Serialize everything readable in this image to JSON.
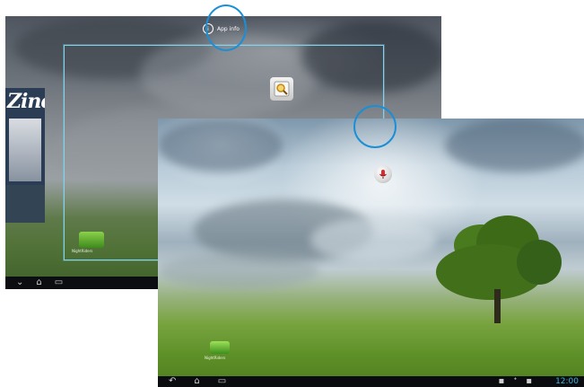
{
  "back_screen": {
    "app_info_label": "App info",
    "magazine_title": "Zine",
    "app_tile_label": "NightRiders",
    "nav": {
      "back_glyph": "⌄",
      "home_glyph": "⌂",
      "recent_glyph": "▭"
    }
  },
  "front_screen": {
    "app_tile_label": "NightRiders",
    "clock": "12:00",
    "nav": {
      "back_glyph": "↶",
      "home_glyph": "⌂",
      "recent_glyph": "▭"
    },
    "status_icons": [
      "▪",
      "ᐩ",
      "▪"
    ]
  },
  "highlight_color": "#1b8fd6",
  "selection_color": "#7fd3ee",
  "icons": [
    "info-icon",
    "search-icon",
    "microphone-icon",
    "app-icon",
    "back-icon",
    "home-icon",
    "recent-apps-icon"
  ]
}
